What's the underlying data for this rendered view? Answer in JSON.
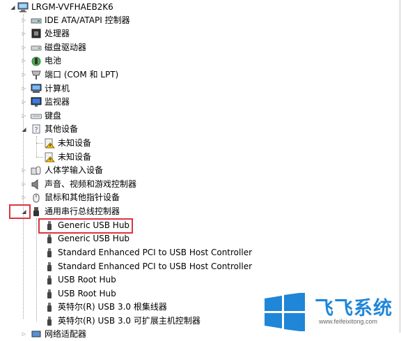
{
  "computer_name": "LRGM-VVFHAEB2K6",
  "categories": {
    "ide": "IDE ATA/ATAPI 控制器",
    "processor": "处理器",
    "disk": "磁盘驱动器",
    "battery": "电池",
    "ports": "端口 (COM 和 LPT)",
    "computer": "计算机",
    "monitor": "监视器",
    "keyboard": "键盘",
    "other": "其他设备",
    "hid": "人体学输入设备",
    "sound": "声音、视频和游戏控制器",
    "mouse": "鼠标和其他指针设备",
    "usb": "通用串行总线控制器"
  },
  "other_devices": [
    "未知设备",
    "未知设备"
  ],
  "usb_devices": [
    "Generic USB Hub",
    "Generic USB Hub",
    "Standard Enhanced PCI to USB Host Controller",
    "Standard Enhanced PCI to USB Host Controller",
    "USB Root Hub",
    "USB Root Hub",
    "英特尔(R) USB 3.0 根集线器",
    "英特尔(R) USB 3.0 可扩展主机控制器"
  ],
  "cut_off_category": "网络适配器",
  "watermark": {
    "brand": "飞飞系统",
    "url": "www.feifeixitong.com"
  },
  "colors": {
    "highlight_box": "#d9363e",
    "watermark_blue": "#1f86d8"
  }
}
